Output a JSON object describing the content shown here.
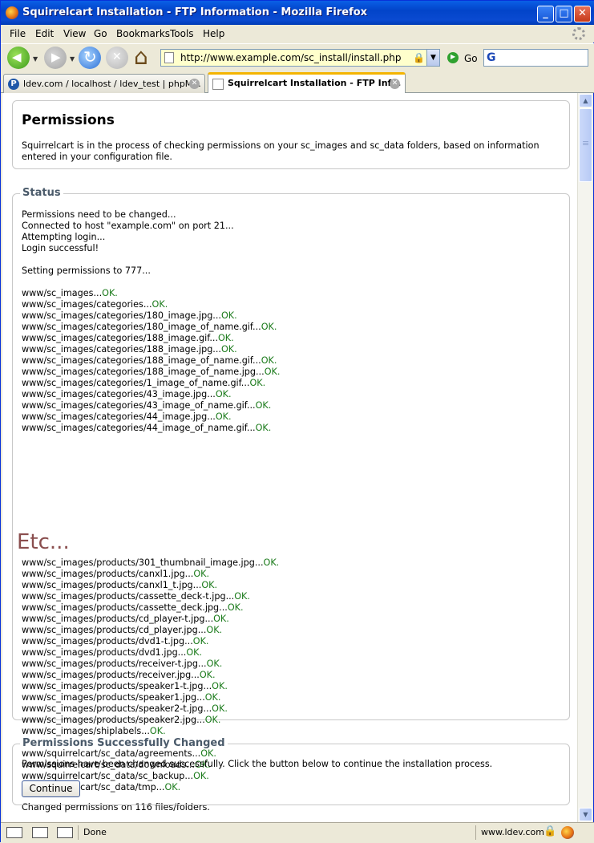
{
  "window": {
    "title": "Squirrelcart Installation - FTP Information - Mozilla Firefox",
    "controls": {
      "minimize": "_",
      "maximize": "□",
      "close": "✕"
    }
  },
  "menu": [
    {
      "label": "File"
    },
    {
      "label": "Edit"
    },
    {
      "label": "View"
    },
    {
      "label": "Go"
    },
    {
      "label": "Bookmarks"
    },
    {
      "label": "Tools"
    },
    {
      "label": "Help"
    }
  ],
  "toolbar": {
    "url": "http://www.example.com/sc_install/install.php",
    "go_label": "Go",
    "search_engine": "G",
    "search_value": ""
  },
  "tabs": [
    {
      "label": "ldev.com / localhost / ldev_test | phpM...",
      "active": false,
      "favicon": "phpmyadmin-icon"
    },
    {
      "label": "Squirrelcart Installation - FTP Inf...",
      "active": true,
      "favicon": "page-icon"
    }
  ],
  "page": {
    "permissions": {
      "heading": "Permissions",
      "description": "Squirrelcart is in the process of checking permissions on your sc_images and sc_data folders, based on information entered in your configuration file."
    },
    "status": {
      "legend": "Status",
      "intro": [
        "Permissions need to be changed...",
        "Connected to host \"example.com\" on port 21...",
        "Attempting login...",
        "Login successful!",
        "",
        "Setting permissions to 777...",
        ""
      ],
      "ok_text": "OK.",
      "files_before": [
        "www/sc_images...",
        "www/sc_images/categories...",
        "www/sc_images/categories/180_image.jpg...",
        "www/sc_images/categories/180_image_of_name.gif...",
        "www/sc_images/categories/188_image.gif...",
        "www/sc_images/categories/188_image.jpg...",
        "www/sc_images/categories/188_image_of_name.gif...",
        "www/sc_images/categories/188_image_of_name.jpg...",
        "www/sc_images/categories/1_image_of_name.gif...",
        "www/sc_images/categories/43_image.jpg...",
        "www/sc_images/categories/43_image_of_name.gif...",
        "www/sc_images/categories/44_image.jpg...",
        "www/sc_images/categories/44_image_of_name.gif..."
      ],
      "etc": "Etc...",
      "files_after": [
        "www/sc_images/products/301_thumbnail_image.jpg...",
        "www/sc_images/products/canxl1.jpg...",
        "www/sc_images/products/canxl1_t.jpg...",
        "www/sc_images/products/cassette_deck-t.jpg...",
        "www/sc_images/products/cassette_deck.jpg...",
        "www/sc_images/products/cd_player-t.jpg...",
        "www/sc_images/products/cd_player.jpg...",
        "www/sc_images/products/dvd1-t.jpg...",
        "www/sc_images/products/dvd1.jpg...",
        "www/sc_images/products/receiver-t.jpg...",
        "www/sc_images/products/receiver.jpg...",
        "www/sc_images/products/speaker1-t.jpg...",
        "www/sc_images/products/speaker1.jpg...",
        "www/sc_images/products/speaker2-t.jpg...",
        "www/sc_images/products/speaker2.jpg...",
        "www/sc_images/shiplabels...",
        "www/squirrelcart/sc_data...",
        "www/squirrelcart/sc_data/agreements...",
        "www/squirrelcart/sc_data/downloads...",
        "www/squirrelcart/sc_data/sc_backup...",
        "www/squirrelcart/sc_data/tmp..."
      ],
      "summary": "Changed permissions on 116 files/folders."
    },
    "success": {
      "legend": "Permissions Successfully Changed",
      "message": "Permissions have been changed successfully. Click the button below to continue the installation process.",
      "button": "Continue"
    }
  },
  "statusbar": {
    "text": "Done",
    "host": "www.ldev.com"
  }
}
